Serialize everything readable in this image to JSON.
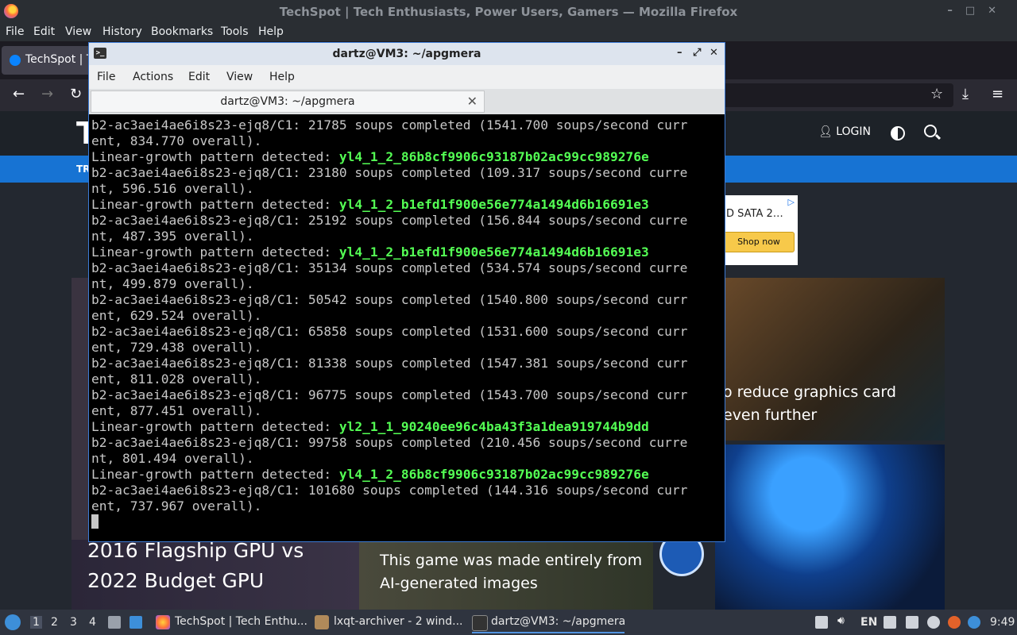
{
  "firefox": {
    "window_title": "TechSpot | Tech Enthusiasts, Power Users, Gamers — Mozilla Firefox",
    "menu": [
      "File",
      "Edit",
      "View",
      "History",
      "Bookmarks",
      "Tools",
      "Help"
    ],
    "tab_label": "TechSpot | T"
  },
  "site": {
    "logo": "T",
    "login": "LOGIN",
    "nav_first": "TR",
    "ad_text": "D SATA 2…",
    "ad_button": "Shop now",
    "card_right_headline": "o reduce graphics card\neven further",
    "card_bottom_left_headline": "2016 Flagship GPU vs\n2022 Budget GPU",
    "card_bottom_mid_headline": "This game was made entirely from\nAI-generated images"
  },
  "terminal": {
    "window_title": "dartz@VM3: ~/apgmera",
    "menu": [
      "File",
      "Actions",
      "Edit",
      "View",
      "Help"
    ],
    "tab_label": "dartz@VM3: ~/apgmera",
    "lines": [
      {
        "text": "b2-ac3aei4ae6i8s23-ejq8/C1: 21785 soups completed (1541.700 soups/second curr"
      },
      {
        "text": "ent, 834.770 overall)."
      },
      {
        "text": "Linear-growth pattern detected: ",
        "hl": "yl4_1_2_86b8cf9906c93187b02ac99cc989276e"
      },
      {
        "text": "b2-ac3aei4ae6i8s23-ejq8/C1: 23180 soups completed (109.317 soups/second curre"
      },
      {
        "text": "nt, 596.516 overall)."
      },
      {
        "text": "Linear-growth pattern detected: ",
        "hl": "yl4_1_2_b1efd1f900e56e774a1494d6b16691e3"
      },
      {
        "text": "b2-ac3aei4ae6i8s23-ejq8/C1: 25192 soups completed (156.844 soups/second curre"
      },
      {
        "text": "nt, 487.395 overall)."
      },
      {
        "text": "Linear-growth pattern detected: ",
        "hl": "yl4_1_2_b1efd1f900e56e774a1494d6b16691e3"
      },
      {
        "text": "b2-ac3aei4ae6i8s23-ejq8/C1: 35134 soups completed (534.574 soups/second curre"
      },
      {
        "text": "nt, 499.879 overall)."
      },
      {
        "text": "b2-ac3aei4ae6i8s23-ejq8/C1: 50542 soups completed (1540.800 soups/second curr"
      },
      {
        "text": "ent, 629.524 overall)."
      },
      {
        "text": "b2-ac3aei4ae6i8s23-ejq8/C1: 65858 soups completed (1531.600 soups/second curr"
      },
      {
        "text": "ent, 729.438 overall)."
      },
      {
        "text": "b2-ac3aei4ae6i8s23-ejq8/C1: 81338 soups completed (1547.381 soups/second curr"
      },
      {
        "text": "ent, 811.028 overall)."
      },
      {
        "text": "b2-ac3aei4ae6i8s23-ejq8/C1: 96775 soups completed (1543.700 soups/second curr"
      },
      {
        "text": "ent, 877.451 overall)."
      },
      {
        "text": "Linear-growth pattern detected: ",
        "hl": "yl2_1_1_90240ee96c4ba43f3a1dea919744b9dd"
      },
      {
        "text": "b2-ac3aei4ae6i8s23-ejq8/C1: 99758 soups completed (210.456 soups/second curre"
      },
      {
        "text": "nt, 801.494 overall)."
      },
      {
        "text": "Linear-growth pattern detected: ",
        "hl": "yl4_1_2_86b8cf9906c93187b02ac99cc989276e"
      },
      {
        "text": "b2-ac3aei4ae6i8s23-ejq8/C1: 101680 soups completed (144.316 soups/second curr"
      },
      {
        "text": "ent, 737.967 overall)."
      }
    ]
  },
  "taskbar": {
    "workspaces": [
      "1",
      "2",
      "3",
      "4"
    ],
    "items": [
      {
        "label": "TechSpot | Tech Enthu...",
        "icon": "firefox-icon"
      },
      {
        "label": "lxqt-archiver - 2 wind...",
        "icon": "archive-icon"
      },
      {
        "label": "dartz@VM3: ~/apgmera",
        "icon": "terminal-icon"
      }
    ],
    "language": "EN",
    "clock": "9:49"
  }
}
